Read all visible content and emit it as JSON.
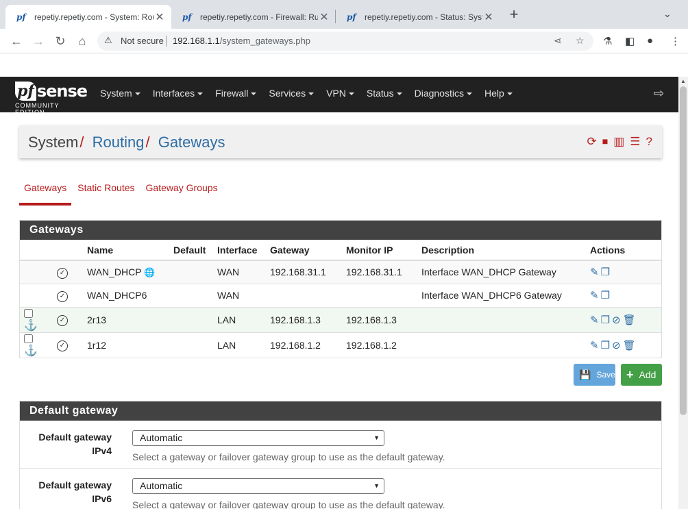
{
  "browser": {
    "tabs": [
      {
        "favicon": "pf",
        "title": "repetiy.repetiy.com - System: Rou"
      },
      {
        "favicon": "pf",
        "title": "repetiy.repetiy.com - Firewall: Rul"
      },
      {
        "favicon": "pf",
        "title": "repetiy.repetiy.com - Status: Syste"
      }
    ],
    "security": "Not secure",
    "url_host": "192.168.1.1",
    "url_path": "/system_gateways.php"
  },
  "navbar": {
    "logo_pf": "pf",
    "logo_sense": "sense",
    "logo_sub": "COMMUNITY EDITION",
    "menu": [
      "System",
      "Interfaces",
      "Firewall",
      "Services",
      "VPN",
      "Status",
      "Diagnostics",
      "Help"
    ]
  },
  "breadcrumb": {
    "system": "System",
    "routing": "Routing",
    "gateways": "Gateways"
  },
  "page_tabs": [
    "Gateways",
    "Static Routes",
    "Gateway Groups"
  ],
  "gateways_panel": {
    "title": "Gateways",
    "headers": {
      "name": "Name",
      "default": "Default",
      "interface": "Interface",
      "gateway": "Gateway",
      "monitor": "Monitor IP",
      "description": "Description",
      "actions": "Actions"
    },
    "rows": [
      {
        "name": "WAN_DHCP",
        "interface": "WAN",
        "gateway": "192.168.31.1",
        "monitor": "192.168.31.1",
        "description": "Interface WAN_DHCP Gateway"
      },
      {
        "name": "WAN_DHCP6",
        "interface": "WAN",
        "gateway": "",
        "monitor": "",
        "description": "Interface WAN_DHCP6 Gateway"
      },
      {
        "name": "2r13",
        "interface": "LAN",
        "gateway": "192.168.1.3",
        "monitor": "192.168.1.3",
        "description": ""
      },
      {
        "name": "1r12",
        "interface": "LAN",
        "gateway": "192.168.1.2",
        "monitor": "192.168.1.2",
        "description": ""
      }
    ]
  },
  "buttons": {
    "save": "Save",
    "add": "Add"
  },
  "default_panel": {
    "title": "Default gateway",
    "ipv4": {
      "label_line1": "Default gateway",
      "label_line2": "IPv4",
      "value": "Automatic",
      "help": "Select a gateway or failover gateway group to use as the default gateway."
    },
    "ipv6": {
      "label_line1": "Default gateway",
      "label_line2": "IPv6",
      "value": "Automatic",
      "help": "Select a gateway or failover gateway group to use as the default gateway."
    }
  }
}
